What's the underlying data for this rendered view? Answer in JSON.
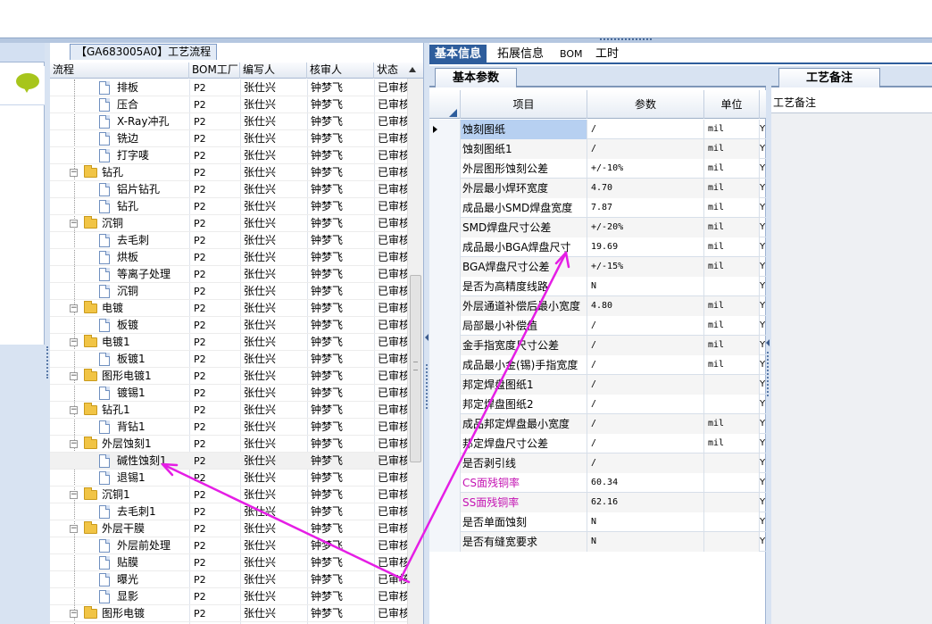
{
  "process_panel": {
    "title": "【GA683005A0】工艺流程",
    "columns": [
      "流程",
      "BOM工厂",
      "编写人",
      "核审人",
      "状态"
    ],
    "rows": [
      {
        "level": 2,
        "type": "step",
        "name": "排板",
        "factory": "P2",
        "writer": "张仕兴",
        "checker": "钟梦飞",
        "status": "已审核"
      },
      {
        "level": 2,
        "type": "step",
        "name": "压合",
        "factory": "P2",
        "writer": "张仕兴",
        "checker": "钟梦飞",
        "status": "已审核"
      },
      {
        "level": 2,
        "type": "step",
        "name": "X-Ray冲孔",
        "factory": "P2",
        "writer": "张仕兴",
        "checker": "钟梦飞",
        "status": "已审核"
      },
      {
        "level": 2,
        "type": "step",
        "name": "铣边",
        "factory": "P2",
        "writer": "张仕兴",
        "checker": "钟梦飞",
        "status": "已审核"
      },
      {
        "level": 2,
        "type": "step",
        "name": "打字唛",
        "factory": "P2",
        "writer": "张仕兴",
        "checker": "钟梦飞",
        "status": "已审核"
      },
      {
        "level": 1,
        "type": "group",
        "name": "钻孔",
        "factory": "P2",
        "writer": "张仕兴",
        "checker": "钟梦飞",
        "status": "已审核"
      },
      {
        "level": 2,
        "type": "step",
        "name": "铝片钻孔",
        "factory": "P2",
        "writer": "张仕兴",
        "checker": "钟梦飞",
        "status": "已审核"
      },
      {
        "level": 2,
        "type": "step",
        "name": "钻孔",
        "factory": "P2",
        "writer": "张仕兴",
        "checker": "钟梦飞",
        "status": "已审核"
      },
      {
        "level": 1,
        "type": "group",
        "name": "沉铜",
        "factory": "P2",
        "writer": "张仕兴",
        "checker": "钟梦飞",
        "status": "已审核"
      },
      {
        "level": 2,
        "type": "step",
        "name": "去毛刺",
        "factory": "P2",
        "writer": "张仕兴",
        "checker": "钟梦飞",
        "status": "已审核"
      },
      {
        "level": 2,
        "type": "step",
        "name": "烘板",
        "factory": "P2",
        "writer": "张仕兴",
        "checker": "钟梦飞",
        "status": "已审核"
      },
      {
        "level": 2,
        "type": "step",
        "name": "等离子处理",
        "factory": "P2",
        "writer": "张仕兴",
        "checker": "钟梦飞",
        "status": "已审核"
      },
      {
        "level": 2,
        "type": "step",
        "name": "沉铜",
        "factory": "P2",
        "writer": "张仕兴",
        "checker": "钟梦飞",
        "status": "已审核"
      },
      {
        "level": 1,
        "type": "group",
        "name": "电镀",
        "factory": "P2",
        "writer": "张仕兴",
        "checker": "钟梦飞",
        "status": "已审核"
      },
      {
        "level": 2,
        "type": "step",
        "name": "板镀",
        "factory": "P2",
        "writer": "张仕兴",
        "checker": "钟梦飞",
        "status": "已审核"
      },
      {
        "level": 1,
        "type": "group",
        "name": "电镀1",
        "factory": "P2",
        "writer": "张仕兴",
        "checker": "钟梦飞",
        "status": "已审核"
      },
      {
        "level": 2,
        "type": "step",
        "name": "板镀1",
        "factory": "P2",
        "writer": "张仕兴",
        "checker": "钟梦飞",
        "status": "已审核"
      },
      {
        "level": 1,
        "type": "group",
        "name": "图形电镀1",
        "factory": "P2",
        "writer": "张仕兴",
        "checker": "钟梦飞",
        "status": "已审核"
      },
      {
        "level": 2,
        "type": "step",
        "name": "镀锡1",
        "factory": "P2",
        "writer": "张仕兴",
        "checker": "钟梦飞",
        "status": "已审核"
      },
      {
        "level": 1,
        "type": "group",
        "name": "钻孔1",
        "factory": "P2",
        "writer": "张仕兴",
        "checker": "钟梦飞",
        "status": "已审核"
      },
      {
        "level": 2,
        "type": "step",
        "name": "背钻1",
        "factory": "P2",
        "writer": "张仕兴",
        "checker": "钟梦飞",
        "status": "已审核"
      },
      {
        "level": 1,
        "type": "group",
        "name": "外层蚀刻1",
        "factory": "P2",
        "writer": "张仕兴",
        "checker": "钟梦飞",
        "status": "已审核"
      },
      {
        "level": 2,
        "type": "step",
        "name": "碱性蚀刻1",
        "factory": "P2",
        "writer": "张仕兴",
        "checker": "钟梦飞",
        "status": "已审核",
        "selected": true
      },
      {
        "level": 2,
        "type": "step",
        "name": "退锡1",
        "factory": "P2",
        "writer": "张仕兴",
        "checker": "钟梦飞",
        "status": "已审核"
      },
      {
        "level": 1,
        "type": "group",
        "name": "沉铜1",
        "factory": "P2",
        "writer": "张仕兴",
        "checker": "钟梦飞",
        "status": "已审核"
      },
      {
        "level": 2,
        "type": "step",
        "name": "去毛刺1",
        "factory": "P2",
        "writer": "张仕兴",
        "checker": "钟梦飞",
        "status": "已审核"
      },
      {
        "level": 1,
        "type": "group",
        "name": "外层干膜",
        "factory": "P2",
        "writer": "张仕兴",
        "checker": "钟梦飞",
        "status": "已审核"
      },
      {
        "level": 2,
        "type": "step",
        "name": "外层前处理",
        "factory": "P2",
        "writer": "张仕兴",
        "checker": "钟梦飞",
        "status": "已审核"
      },
      {
        "level": 2,
        "type": "step",
        "name": "贴膜",
        "factory": "P2",
        "writer": "张仕兴",
        "checker": "钟梦飞",
        "status": "已审核"
      },
      {
        "level": 2,
        "type": "step",
        "name": "曝光",
        "factory": "P2",
        "writer": "张仕兴",
        "checker": "钟梦飞",
        "status": "已审核"
      },
      {
        "level": 2,
        "type": "step",
        "name": "显影",
        "factory": "P2",
        "writer": "张仕兴",
        "checker": "钟梦飞",
        "status": "已审核"
      },
      {
        "level": 1,
        "type": "group",
        "name": "图形电镀",
        "factory": "P2",
        "writer": "张仕兴",
        "checker": "钟梦飞",
        "status": "已审核"
      }
    ]
  },
  "tabs": [
    {
      "label": "基本信息",
      "active": true
    },
    {
      "label": "拓展信息",
      "active": false
    },
    {
      "label": "BOM",
      "active": false
    },
    {
      "label": "工时",
      "active": false
    }
  ],
  "params_panel": {
    "subtab": "基本参数",
    "columns": [
      "项目",
      "参数",
      "单位"
    ],
    "rows": [
      {
        "item": "蚀刻图纸",
        "value": "/",
        "unit": "mil",
        "flag": "Y",
        "current": true
      },
      {
        "item": "蚀刻图纸1",
        "value": "/",
        "unit": "mil",
        "flag": "Y"
      },
      {
        "item": "外层图形蚀刻公差",
        "value": "+/-10%",
        "unit": "mil",
        "flag": "Y"
      },
      {
        "item": "外层最小焊环宽度",
        "value": "4.70",
        "unit": "mil",
        "flag": "Y"
      },
      {
        "item": "成品最小SMD焊盘宽度",
        "value": "7.87",
        "unit": "mil",
        "flag": "Y"
      },
      {
        "item": "SMD焊盘尺寸公差",
        "value": "+/-20%",
        "unit": "mil",
        "flag": "Y"
      },
      {
        "item": "成品最小BGA焊盘尺寸",
        "value": "19.69",
        "unit": "mil",
        "flag": "Y"
      },
      {
        "item": "BGA焊盘尺寸公差",
        "value": "+/-15%",
        "unit": "mil",
        "flag": "Y"
      },
      {
        "item": "是否为高精度线路",
        "value": "N",
        "unit": "",
        "flag": "Y"
      },
      {
        "item": "外层通道补偿后最小宽度",
        "value": "4.80",
        "unit": "mil",
        "flag": "Y"
      },
      {
        "item": "局部最小补偿值",
        "value": "/",
        "unit": "mil",
        "flag": "Y"
      },
      {
        "item": "金手指宽度尺寸公差",
        "value": "/",
        "unit": "mil",
        "flag": "Y"
      },
      {
        "item": "成品最小金(锡)手指宽度",
        "value": "/",
        "unit": "mil",
        "flag": "Y"
      },
      {
        "item": "邦定焊盘图纸1",
        "value": "/",
        "unit": "",
        "flag": "Y"
      },
      {
        "item": "邦定焊盘图纸2",
        "value": "/",
        "unit": "",
        "flag": "Y"
      },
      {
        "item": "成品邦定焊盘最小宽度",
        "value": "/",
        "unit": "mil",
        "flag": "Y"
      },
      {
        "item": "邦定焊盘尺寸公差",
        "value": "/",
        "unit": "mil",
        "flag": "Y"
      },
      {
        "item": "是否剥引线",
        "value": "/",
        "unit": "",
        "flag": "Y"
      },
      {
        "item": "CS面残铜率",
        "value": "60.34",
        "unit": "",
        "flag": "Y",
        "highlight": true
      },
      {
        "item": "SS面残铜率",
        "value": "62.16",
        "unit": "",
        "flag": "Y",
        "highlight": true
      },
      {
        "item": "是否单面蚀刻",
        "value": "N",
        "unit": "",
        "flag": "Y"
      },
      {
        "item": "是否有缝宽要求",
        "value": "N",
        "unit": "",
        "flag": "Y"
      }
    ]
  },
  "notes_panel": {
    "tab": "工艺备注",
    "label": "工艺备注"
  },
  "colors": {
    "accent": "#2e5d9c",
    "annotation": "#e51ee5",
    "highlight_text": "#c414b3",
    "selection": "#b7d0f1"
  }
}
